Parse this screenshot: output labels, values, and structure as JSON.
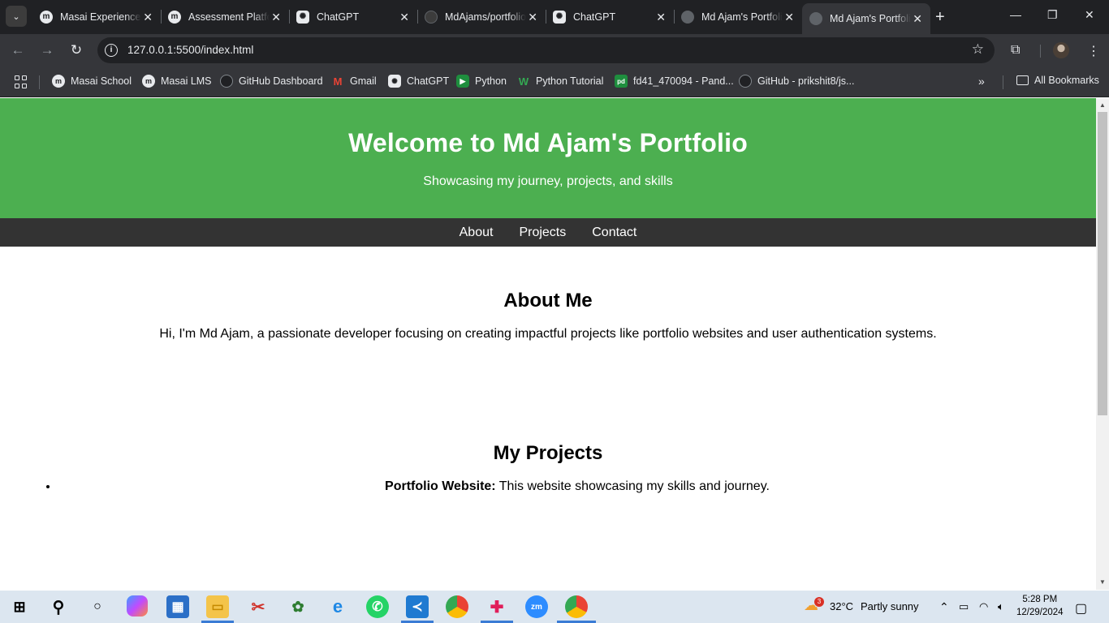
{
  "browser": {
    "tabs": [
      {
        "title": "Masai Experience",
        "icon": "masai-favicon"
      },
      {
        "title": "Assessment Platform",
        "icon": "masai-favicon"
      },
      {
        "title": "ChatGPT",
        "icon": "chatgpt-favicon"
      },
      {
        "title": "MdAjams/portfolio",
        "icon": "github-favicon"
      },
      {
        "title": "ChatGPT",
        "icon": "chatgpt-favicon"
      },
      {
        "title": "Md Ajam's Portfolio",
        "icon": "globe-favicon"
      },
      {
        "title": "Md Ajam's Portfolio",
        "icon": "globe-favicon",
        "active": true
      }
    ],
    "url": "127.0.0.1:5500/index.html",
    "bookmarks": [
      {
        "label": "Masai School",
        "icon": "masai"
      },
      {
        "label": "Masai LMS",
        "icon": "masai"
      },
      {
        "label": "GitHub Dashboard",
        "icon": "github"
      },
      {
        "label": "Gmail",
        "icon": "gmail"
      },
      {
        "label": "ChatGPT",
        "icon": "chatgpt"
      },
      {
        "label": "Python",
        "icon": "python"
      },
      {
        "label": "Python Tutorial",
        "icon": "w3schools"
      },
      {
        "label": "fd41_470094 - Pand...",
        "icon": "pandas"
      },
      {
        "label": "GitHub - prikshit8/js...",
        "icon": "github"
      }
    ],
    "all_bookmarks": "All Bookmarks"
  },
  "page": {
    "header": {
      "title": "Welcome to Md Ajam's Portfolio",
      "subtitle": "Showcasing my journey, projects, and skills"
    },
    "nav": [
      "About",
      "Projects",
      "Contact"
    ],
    "about": {
      "heading": "About Me",
      "text": "Hi, I'm Md Ajam, a passionate developer focusing on creating impactful projects like portfolio websites and user authentication systems."
    },
    "projects": {
      "heading": "My Projects",
      "items": [
        {
          "name": "Portfolio Website:",
          "desc": " This website showcasing my skills and journey."
        }
      ]
    }
  },
  "taskbar": {
    "weather_temp": "32°C",
    "weather_text": "Partly sunny",
    "weather_badge": "3",
    "time": "5:28 PM",
    "date": "12/29/2024"
  },
  "colors": {
    "header_green": "#4caf50",
    "nav_dark": "#333333",
    "browser_dark": "#202124",
    "browser_toolbar": "#35363a"
  }
}
